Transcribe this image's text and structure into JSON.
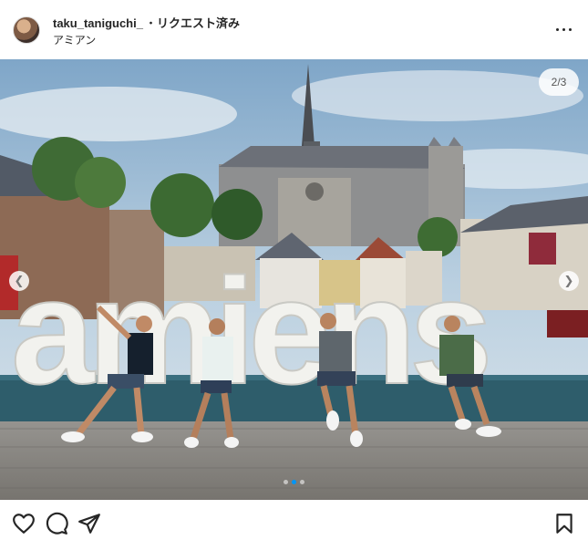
{
  "post": {
    "username": "taku_taniguchi_",
    "separator": "・",
    "status": "リクエスト済み",
    "location": "アミアン"
  },
  "media": {
    "counter": "2/3",
    "total_slides": 3,
    "active_slide": 2,
    "sign_text": "amiens"
  },
  "icons": {
    "more": "more-horizontal-icon",
    "like": "heart-icon",
    "comment": "comment-icon",
    "share": "send-icon",
    "save": "bookmark-icon"
  },
  "colors": {
    "accent": "#0095f6",
    "text": "#262626"
  }
}
